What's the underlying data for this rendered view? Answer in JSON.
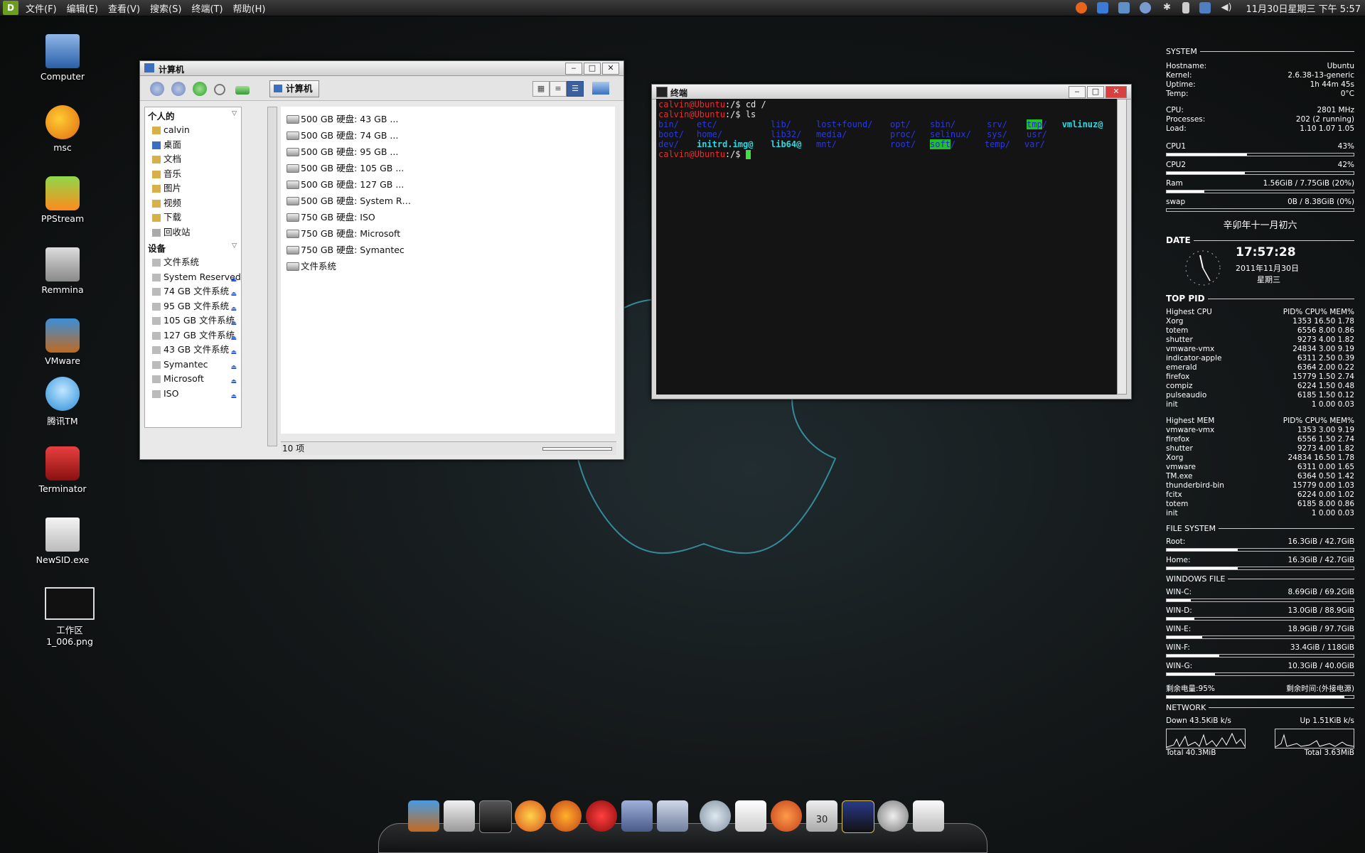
{
  "topbar": {
    "logo": "D",
    "menus": [
      "文件(F)",
      "编辑(E)",
      "查看(V)",
      "搜索(S)",
      "终端(T)",
      "帮助(H)"
    ],
    "clock": "11月30日星期三 下午 5:57"
  },
  "desktop": {
    "icons": [
      {
        "label": "Computer",
        "icon": "computer-icon"
      },
      {
        "label": "msc",
        "icon": "msc-icon"
      },
      {
        "label": "PPStream",
        "icon": "ppstream-icon"
      },
      {
        "label": "Remmina",
        "icon": "remmina-icon"
      },
      {
        "label": "VMware",
        "icon": "vmware-icon"
      },
      {
        "label": "腾讯TM",
        "icon": "tm-icon"
      },
      {
        "label": "Terminator",
        "icon": "terminator-icon"
      },
      {
        "label": "NewSID.exe",
        "icon": "exe-icon"
      },
      {
        "label": "工作区 1_006.png",
        "icon": "image-icon"
      }
    ]
  },
  "filemanager": {
    "title": "计算机",
    "location": "计算机",
    "sidebar": {
      "personal_header": "个人的",
      "personal": [
        "calvin",
        "桌面",
        "文档",
        "音乐",
        "图片",
        "视频",
        "下载",
        "回收站"
      ],
      "devices_header": "设备",
      "devices": [
        "文件系统",
        "System Reserved",
        "74 GB 文件系统",
        "95 GB 文件系统",
        "105 GB 文件系统",
        "127 GB 文件系统",
        "43 GB 文件系统",
        "Symantec",
        "Microsoft",
        "ISO"
      ]
    },
    "items": [
      "500 GB 硬盘: 43 GB ...",
      "500 GB 硬盘: 74 GB ...",
      "500 GB 硬盘: 95 GB ...",
      "500 GB 硬盘: 105 GB ...",
      "500 GB 硬盘: 127 GB ...",
      "500 GB 硬盘: System R…",
      "750 GB 硬盘: ISO",
      "750 GB 硬盘: Microsoft",
      "750 GB 硬盘: Symantec",
      "文件系统"
    ],
    "status": "10 项"
  },
  "terminal": {
    "title": "终端",
    "prompt_user": "calvin@Ubuntu",
    "prompt_path": ":/$ ",
    "cmd1": "cd /",
    "cmd2": "ls",
    "ls": {
      "row1": [
        "bin/",
        "etc/",
        "lib/",
        "lost+found/",
        "opt/",
        "sbin/",
        "srv/",
        "tmp",
        "/",
        "vmlinuz@"
      ],
      "row2": [
        "boot/",
        "home/",
        "lib32/",
        "media/",
        "proc/",
        "selinux/",
        "sys/",
        "usr/"
      ],
      "row3": [
        "dev/",
        "initrd.img@",
        "lib64@",
        "mnt/",
        "root/",
        "soft",
        "/",
        "temp/",
        "var/"
      ]
    }
  },
  "conky": {
    "system_header": "SYSTEM",
    "hostname_label": "Hostname:",
    "hostname": "Ubuntu",
    "kernel_label": "Kernel:",
    "kernel": "2.6.38-13-generic",
    "uptime_label": "Uptime:",
    "uptime": "1h 44m 45s",
    "temp_label": "Temp:",
    "temp": "0°C",
    "cpu_label": "CPU:",
    "cpu": "2801 MHz",
    "processes_label": "Processes:",
    "processes": "202 (2 running)",
    "load_label": "Load:",
    "load": "1.10 1.07 1.05",
    "cpu1_label": "CPU1",
    "cpu1": "43%",
    "cpu1_level": 0.43,
    "cpu2_label": "CPU2",
    "cpu2": "42%",
    "cpu2_level": 0.42,
    "ram_label": "Ram",
    "ram": "1.56GiB / 7.75GiB (20%)",
    "ram_level": 0.2,
    "swap_label": "swap",
    "swap": "0B   / 8.38GiB (0%)",
    "swap_level": 0.0,
    "lunar": "辛卯年十一月初六",
    "date_header": "DATE",
    "time": "17:57:28",
    "date": "2011年11月30日",
    "weekday": "星期三",
    "toppid_header": "TOP PID",
    "highcpu_label": "Highest CPU",
    "cols": "PID% CPU% MEM%",
    "highcpu": [
      [
        "Xorg",
        "1353 16.50  1.78"
      ],
      [
        "totem",
        "6556  8.00  0.86"
      ],
      [
        "shutter",
        "9273  4.00  1.82"
      ],
      [
        "vmware-vmx",
        "24834  3.00  9.19"
      ],
      [
        "indicator-apple",
        "6311  2.50  0.39"
      ],
      [
        "emerald",
        "6364  2.00  0.22"
      ],
      [
        "firefox",
        "15779  1.50  2.74"
      ],
      [
        "compiz",
        "6224  1.50  0.48"
      ],
      [
        "pulseaudio",
        "6185  1.50  0.12"
      ],
      [
        "init",
        "1  0.00  0.03"
      ]
    ],
    "highmem_label": "Highest MEM",
    "highmem": [
      [
        "vmware-vmx",
        "1353  3.00  9.19"
      ],
      [
        "firefox",
        "6556  1.50  2.74"
      ],
      [
        "shutter",
        "9273  4.00  1.82"
      ],
      [
        "Xorg",
        "24834 16.50  1.78"
      ],
      [
        "vmware",
        "6311  0.00  1.65"
      ],
      [
        "TM.exe",
        "6364  0.50  1.42"
      ],
      [
        "thunderbird-bin",
        "15779  0.00  1.03"
      ],
      [
        "fcitx",
        "6224  0.00  1.02"
      ],
      [
        "totem",
        "6185  8.00  0.86"
      ],
      [
        "init",
        "1  0.00  0.03"
      ]
    ],
    "fs_header": "FILE SYSTEM",
    "fs": [
      {
        "label": "Root:",
        "value": "16.3GiB / 42.7GiB",
        "level": 0.38
      },
      {
        "label": "Home:",
        "value": "16.3GiB / 42.7GiB",
        "level": 0.38
      }
    ],
    "winfile_header": "WINDOWS FILE",
    "winfile": [
      {
        "label": "WIN-C:",
        "value": "8.69GiB / 69.2GiB",
        "level": 0.13
      },
      {
        "label": "WIN-D:",
        "value": "13.0GiB / 88.9GiB",
        "level": 0.15
      },
      {
        "label": "WIN-E:",
        "value": "18.9GiB / 97.7GiB",
        "level": 0.19
      },
      {
        "label": "WIN-F:",
        "value": "33.4GiB / 118GiB",
        "level": 0.28
      },
      {
        "label": "WIN-G:",
        "value": "10.3GiB / 40.0GiB",
        "level": 0.26
      }
    ],
    "battery_left": "剩余电量:95%",
    "battery_right": "剩余时间:(外接电源)",
    "battery_level": 0.95,
    "network_header": "NETWORK",
    "down": "Down 43.5KiB k/s",
    "up": "Up 1.51KiB k/s",
    "total_down": "Total 40.3MiB",
    "total_up": "Total 3.63MiB"
  },
  "dock": {
    "icons": [
      "vmware-icon",
      "home-icon",
      "terminal-icon",
      "flame-icon",
      "firefox-icon",
      "opera-icon",
      "app-icon",
      "tools-icon",
      "search-icon",
      "document-icon",
      "ubuntu-icon",
      "calendar-icon",
      "cpu-ram-monitor-icon",
      "power-icon",
      "mail-icon"
    ],
    "calendar_day": "30"
  },
  "colors": {
    "accent": "#2b5bd8",
    "term_red": "#e23030",
    "term_blue": "#2a39e0",
    "term_green": "#3fe03f"
  }
}
